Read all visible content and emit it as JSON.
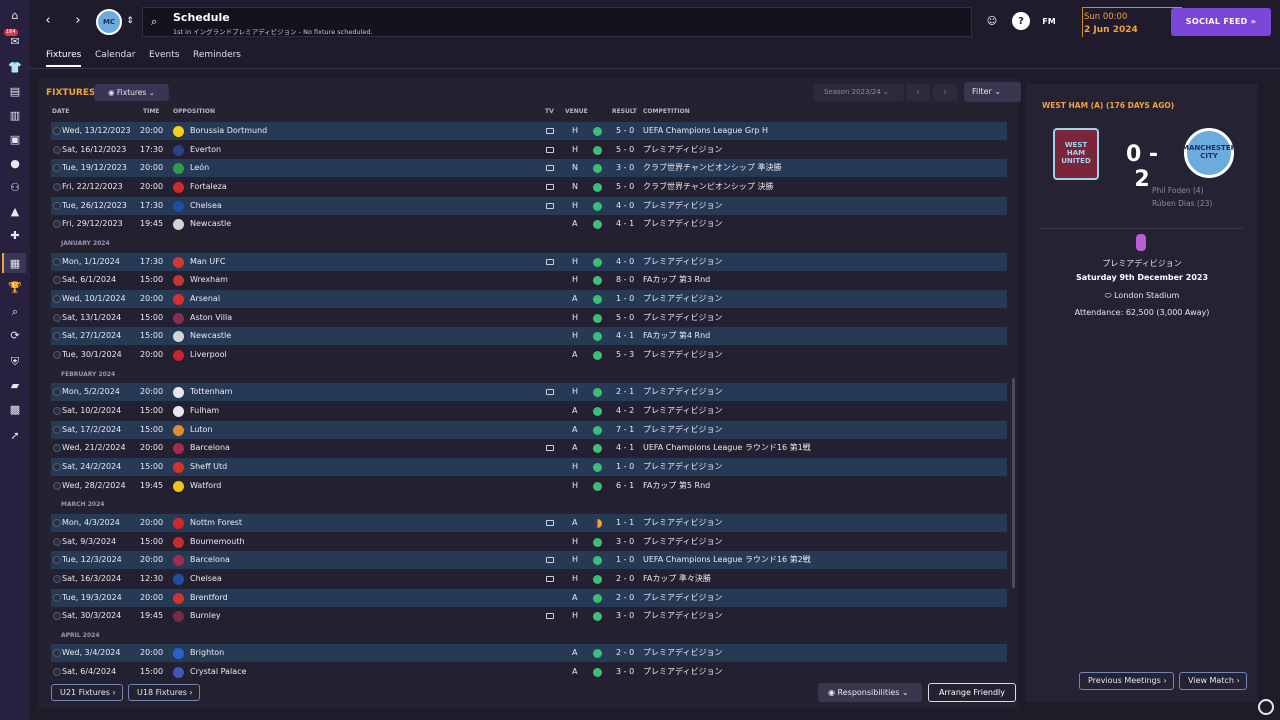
{
  "app": {
    "notifications_badge": "164"
  },
  "header": {
    "title": "Schedule",
    "subtitle": "1st in イングランドプレミアディビジョン - No fixture scheduled.",
    "date_line1": "Sun 00:00",
    "date_line2": "2 Jun 2024",
    "fm_label": "FM",
    "help_label": "?",
    "social_feed": "SOCIAL FEED"
  },
  "tabs": [
    "Fixtures",
    "Calendar",
    "Events",
    "Reminders"
  ],
  "fixtures_panel": {
    "title": "FIXTURES",
    "view_dropdown": "Fixtures",
    "season": "Season 2023/24",
    "filter_label": "Filter",
    "columns": {
      "date": "DATE",
      "time": "TIME",
      "opposition": "OPPOSITION",
      "tv": "TV",
      "venue": "VENUE",
      "result": "RESULT",
      "competition": "COMPETITION"
    },
    "rows": [
      {
        "type": "fixture",
        "date": "Wed, 13/12/2023",
        "time": "20:00",
        "opp": "Borussia Dortmund",
        "tv": true,
        "venue": "H",
        "result": "5 - 0",
        "comp": "UEFA Champions League Grp H",
        "crest": "#f5d11a",
        "res": "w"
      },
      {
        "type": "fixture",
        "date": "Sat, 16/12/2023",
        "time": "17:30",
        "opp": "Everton",
        "tv": true,
        "venue": "H",
        "result": "5 - 0",
        "comp": "プレミアディビジョン",
        "crest": "#274488",
        "res": "w"
      },
      {
        "type": "fixture",
        "date": "Tue, 19/12/2023",
        "time": "20:00",
        "opp": "León",
        "tv": true,
        "venue": "N",
        "result": "3 - 0",
        "comp": "クラブ世界チャンピオンシップ 準決勝",
        "crest": "#2f9a45",
        "res": "w"
      },
      {
        "type": "fixture",
        "date": "Fri, 22/12/2023",
        "time": "20:00",
        "opp": "Fortaleza",
        "tv": true,
        "venue": "N",
        "result": "5 - 0",
        "comp": "クラブ世界チャンピオンシップ 決勝",
        "crest": "#cd2a2a",
        "res": "w"
      },
      {
        "type": "fixture",
        "date": "Tue, 26/12/2023",
        "time": "17:30",
        "opp": "Chelsea",
        "tv": true,
        "venue": "H",
        "result": "4 - 0",
        "comp": "プレミアディビジョン",
        "crest": "#1d4fa3",
        "res": "w"
      },
      {
        "type": "fixture",
        "date": "Fri, 29/12/2023",
        "time": "19:45",
        "opp": "Newcastle",
        "tv": false,
        "venue": "A",
        "result": "4 - 1",
        "comp": "プレミアディビジョン",
        "crest": "#d4d4d4",
        "res": "w"
      },
      {
        "type": "month",
        "label": "JANUARY 2024"
      },
      {
        "type": "fixture",
        "date": "Mon, 1/1/2024",
        "time": "17:30",
        "opp": "Man UFC",
        "tv": true,
        "venue": "H",
        "result": "4 - 0",
        "comp": "プレミアディビジョン",
        "crest": "#d6382c",
        "res": "w"
      },
      {
        "type": "fixture",
        "date": "Sat, 6/1/2024",
        "time": "15:00",
        "opp": "Wrexham",
        "tv": false,
        "venue": "H",
        "result": "8 - 0",
        "comp": "FAカップ 第3 Rnd",
        "crest": "#c63333",
        "res": "w"
      },
      {
        "type": "fixture",
        "date": "Wed, 10/1/2024",
        "time": "20:00",
        "opp": "Arsenal",
        "tv": false,
        "venue": "A",
        "result": "1 - 0",
        "comp": "プレミアディビジョン",
        "crest": "#d72f2f",
        "res": "w"
      },
      {
        "type": "fixture",
        "date": "Sat, 13/1/2024",
        "time": "15:00",
        "opp": "Aston Villa",
        "tv": false,
        "venue": "H",
        "result": "5 - 0",
        "comp": "プレミアディビジョン",
        "crest": "#8a2d55",
        "res": "w"
      },
      {
        "type": "fixture",
        "date": "Sat, 27/1/2024",
        "time": "15:00",
        "opp": "Newcastle",
        "tv": false,
        "venue": "H",
        "result": "4 - 1",
        "comp": "FAカップ 第4 Rnd",
        "crest": "#d4d4d4",
        "res": "w"
      },
      {
        "type": "fixture",
        "date": "Tue, 30/1/2024",
        "time": "20:00",
        "opp": "Liverpool",
        "tv": false,
        "venue": "A",
        "result": "5 - 3",
        "comp": "プレミアディビジョン",
        "crest": "#c6262e",
        "res": "w"
      },
      {
        "type": "month",
        "label": "FEBRUARY 2024"
      },
      {
        "type": "fixture",
        "date": "Mon, 5/2/2024",
        "time": "20:00",
        "opp": "Tottenham",
        "tv": true,
        "venue": "H",
        "result": "2 - 1",
        "comp": "プレミアディビジョン",
        "crest": "#e8e8ee",
        "res": "w"
      },
      {
        "type": "fixture",
        "date": "Sat, 10/2/2024",
        "time": "15:00",
        "opp": "Fulham",
        "tv": false,
        "venue": "A",
        "result": "4 - 2",
        "comp": "プレミアディビジョン",
        "crest": "#e8e8ee",
        "res": "w"
      },
      {
        "type": "fixture",
        "date": "Sat, 17/2/2024",
        "time": "15:00",
        "opp": "Luton",
        "tv": false,
        "venue": "A",
        "result": "7 - 1",
        "comp": "プレミアディビジョン",
        "crest": "#e9892b",
        "res": "w"
      },
      {
        "type": "fixture",
        "date": "Wed, 21/2/2024",
        "time": "20:00",
        "opp": "Barcelona",
        "tv": true,
        "venue": "A",
        "result": "4 - 1",
        "comp": "UEFA Champions League ラウンド16 第1戦",
        "crest": "#a42b4d",
        "res": "w"
      },
      {
        "type": "fixture",
        "date": "Sat, 24/2/2024",
        "time": "15:00",
        "opp": "Sheff Utd",
        "tv": false,
        "venue": "H",
        "result": "1 - 0",
        "comp": "プレミアディビジョン",
        "crest": "#d6322c",
        "res": "w"
      },
      {
        "type": "fixture",
        "date": "Wed, 28/2/2024",
        "time": "19:45",
        "opp": "Watford",
        "tv": false,
        "venue": "H",
        "result": "6 - 1",
        "comp": "FAカップ 第5 Rnd",
        "crest": "#f0c419",
        "res": "w"
      },
      {
        "type": "month",
        "label": "MARCH 2024"
      },
      {
        "type": "fixture",
        "date": "Mon, 4/3/2024",
        "time": "20:00",
        "opp": "Nottm Forest",
        "tv": true,
        "venue": "A",
        "result": "1 - 1",
        "comp": "プレミアディビジョン",
        "crest": "#d1262b",
        "res": "d"
      },
      {
        "type": "fixture",
        "date": "Sat, 9/3/2024",
        "time": "15:00",
        "opp": "Bournemouth",
        "tv": false,
        "venue": "H",
        "result": "3 - 0",
        "comp": "プレミアディビジョン",
        "crest": "#c92b2b",
        "res": "w"
      },
      {
        "type": "fixture",
        "date": "Tue, 12/3/2024",
        "time": "20:00",
        "opp": "Barcelona",
        "tv": true,
        "venue": "H",
        "result": "1 - 0",
        "comp": "UEFA Champions League ラウンド16 第2戦",
        "crest": "#a42b4d",
        "res": "w"
      },
      {
        "type": "fixture",
        "date": "Sat, 16/3/2024",
        "time": "12:30",
        "opp": "Chelsea",
        "tv": true,
        "venue": "H",
        "result": "2 - 0",
        "comp": "FAカップ 準々決勝",
        "crest": "#1d4fa3",
        "res": "w"
      },
      {
        "type": "fixture",
        "date": "Tue, 19/3/2024",
        "time": "20:00",
        "opp": "Brentford",
        "tv": false,
        "venue": "A",
        "result": "2 - 0",
        "comp": "プレミアディビジョン",
        "crest": "#d6322c",
        "res": "w"
      },
      {
        "type": "fixture",
        "date": "Sat, 30/3/2024",
        "time": "19:45",
        "opp": "Burnley",
        "tv": true,
        "venue": "H",
        "result": "3 - 0",
        "comp": "プレミアディビジョン",
        "crest": "#7a2b45",
        "res": "w"
      },
      {
        "type": "month",
        "label": "APRIL 2024"
      },
      {
        "type": "fixture",
        "date": "Wed, 3/4/2024",
        "time": "20:00",
        "opp": "Brighton",
        "tv": false,
        "venue": "A",
        "result": "2 - 0",
        "comp": "プレミアディビジョン",
        "crest": "#2a62c9",
        "res": "w"
      },
      {
        "type": "fixture",
        "date": "Sat, 6/4/2024",
        "time": "15:00",
        "opp": "Crystal Palace",
        "tv": false,
        "venue": "A",
        "result": "3 - 0",
        "comp": "プレミアディビジョン",
        "crest": "#3a59b8",
        "res": "w"
      }
    ],
    "buttons": {
      "u21": "U21 Fixtures",
      "u18": "U18 Fixtures",
      "responsibilities": "Responsibilities",
      "arrange": "Arrange Friendly"
    }
  },
  "match_panel": {
    "header": "WEST HAM (A) (176 DAYS AGO)",
    "home_crest_text": "WEST HAM UNITED",
    "away_crest_text": "MANCHESTER CITY",
    "score": "0 - 2",
    "scorers": [
      "Phil Foden (4)",
      "Rúben Dias (23)"
    ],
    "competition": "プレミアディビジョン",
    "date": "Saturday 9th December 2023",
    "stadium": "London Stadium",
    "attendance": "Attendance: 62,500 (3,000 Away)",
    "btn_previous": "Previous Meetings",
    "btn_view": "View Match"
  },
  "colors": {
    "accent": "#f0a23c",
    "social": "#7b47d8",
    "win": "#3ebd75"
  }
}
